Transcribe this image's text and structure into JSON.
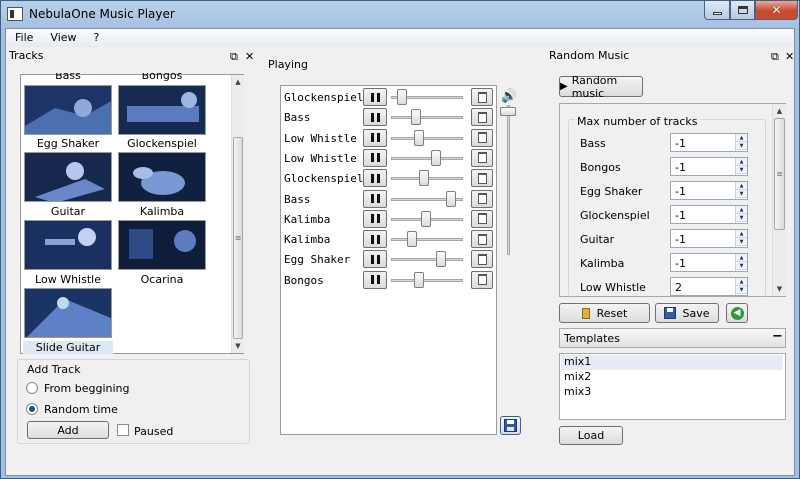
{
  "window": {
    "title": "NebulaOne Music Player"
  },
  "menu": [
    "File",
    "View",
    "?"
  ],
  "tracks_panel": {
    "title": "Tracks",
    "partial_top": [
      "Bass",
      "Bongos"
    ],
    "items": [
      {
        "label": "Egg Shaker"
      },
      {
        "label": "Glockenspiel"
      },
      {
        "label": "Guitar"
      },
      {
        "label": "Kalimba"
      },
      {
        "label": "Low Whistle"
      },
      {
        "label": "Ocarina"
      },
      {
        "label": "Slide Guitar"
      }
    ]
  },
  "add_track": {
    "title": "Add Track",
    "from_beginning": "From beggining",
    "random_time": "Random time",
    "add_button": "Add",
    "paused_label": "Paused"
  },
  "playing": {
    "title": "Playing",
    "tracks": [
      {
        "name": "Glockenspiel",
        "volume": 0.1
      },
      {
        "name": "Bass",
        "volume": 0.32
      },
      {
        "name": "Low Whistle",
        "volume": 0.37
      },
      {
        "name": "Low Whistle",
        "volume": 0.64
      },
      {
        "name": "Glockenspiel",
        "volume": 0.45
      },
      {
        "name": "Bass",
        "volume": 0.88
      },
      {
        "name": "Kalimba",
        "volume": 0.49
      },
      {
        "name": "Kalimba",
        "volume": 0.26
      },
      {
        "name": "Egg Shaker",
        "volume": 0.73
      },
      {
        "name": "Bongos",
        "volume": 0.37
      }
    ],
    "master_volume": 0.95
  },
  "random_music": {
    "title": "Random Music",
    "button": "Random music",
    "max_tracks_title": "Max number of tracks",
    "limits": [
      {
        "name": "Bass",
        "value": "-1"
      },
      {
        "name": "Bongos",
        "value": "-1"
      },
      {
        "name": "Egg Shaker",
        "value": "-1"
      },
      {
        "name": "Glockenspiel",
        "value": "-1"
      },
      {
        "name": "Guitar",
        "value": "-1"
      },
      {
        "name": "Kalimba",
        "value": "-1"
      },
      {
        "name": "Low Whistle",
        "value": "2"
      }
    ],
    "reset": "Reset",
    "save": "Save"
  },
  "templates": {
    "title": "Templates",
    "items": [
      "mix1",
      "mix2",
      "mix3"
    ],
    "load": "Load"
  }
}
